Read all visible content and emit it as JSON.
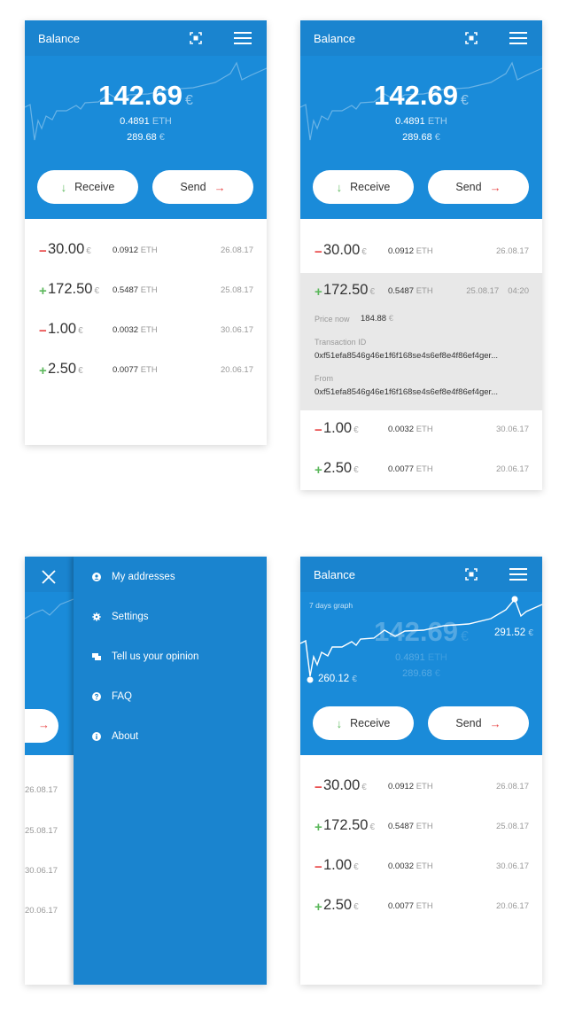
{
  "app": {
    "title": "Balance"
  },
  "balance": {
    "amount": "142.69",
    "currency_symbol": "€",
    "eth_value": "0.4891",
    "eth_unit": "ETH",
    "fiat_value": "289.68",
    "fiat_symbol": "€"
  },
  "actions": {
    "receive_label": "Receive",
    "send_label": "Send",
    "receive_arrow": "↓",
    "send_arrow": "→"
  },
  "transactions": [
    {
      "sign": "−",
      "direction": "out",
      "amount": "30.00",
      "currency": "€",
      "eth": "0.0912",
      "eth_unit": "ETH",
      "date": "26.08.17"
    },
    {
      "sign": "+",
      "direction": "in",
      "amount": "172.50",
      "currency": "€",
      "eth": "0.5487",
      "eth_unit": "ETH",
      "date": "25.08.17",
      "time": "04:20"
    },
    {
      "sign": "−",
      "direction": "out",
      "amount": "1.00",
      "currency": "€",
      "eth": "0.0032",
      "eth_unit": "ETH",
      "date": "30.06.17"
    },
    {
      "sign": "+",
      "direction": "in",
      "amount": "2.50",
      "currency": "€",
      "eth": "0.0077",
      "eth_unit": "ETH",
      "date": "20.06.17"
    }
  ],
  "details": {
    "price_now_label": "Price now",
    "price_now_value": "184.88",
    "price_now_currency": "€",
    "transaction_id_label": "Transaction ID",
    "transaction_id_value": "0xf51efa8546g46e1f6f168se4s6ef8e4f86ef4ger...",
    "from_label": "From",
    "from_value": "0xf51efa8546g46e1f6f168se4s6ef8e4f86ef4ger..."
  },
  "menu": {
    "items": [
      {
        "label": "My addresses",
        "icon": "user-icon"
      },
      {
        "label": "Settings",
        "icon": "gear-icon"
      },
      {
        "label": "Tell us your opinion",
        "icon": "chat-icon"
      },
      {
        "label": "FAQ",
        "icon": "help-icon"
      },
      {
        "label": "About",
        "icon": "info-icon"
      }
    ],
    "close_icon": "close-icon"
  },
  "graph": {
    "label": "7 days graph",
    "min_value": "260.12",
    "max_value": "291.52",
    "currency": "€"
  },
  "colors": {
    "primary": "#1a84cf",
    "header": "#1a8bd9",
    "negative": "#e84545",
    "positive": "#5cb85c"
  }
}
